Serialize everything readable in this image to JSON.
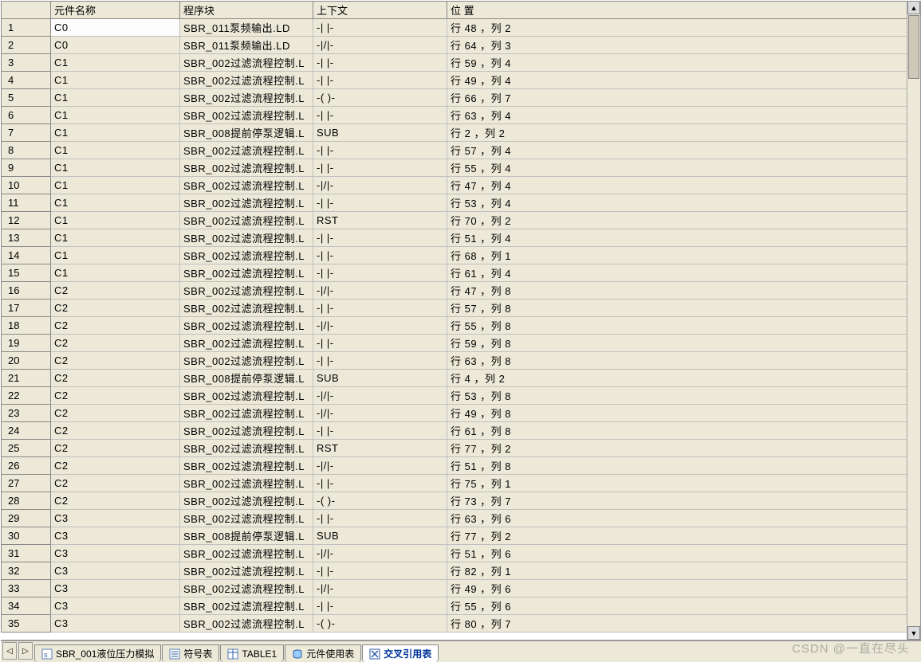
{
  "columns": {
    "name": "元件名称",
    "block": "程序块",
    "context": "上下文",
    "position": "位 置"
  },
  "rows": [
    {
      "n": "1",
      "name": "C0",
      "block": "SBR_011泵频输出.LD",
      "ctx": "-| |-",
      "pos": "行 48 ，列 2"
    },
    {
      "n": "2",
      "name": "C0",
      "block": "SBR_011泵频输出.LD",
      "ctx": "-|/|-",
      "pos": "行 64 ，列 3"
    },
    {
      "n": "3",
      "name": "C1",
      "block": "SBR_002过滤流程控制.L",
      "ctx": "-| |-",
      "pos": "行 59 ，列 4"
    },
    {
      "n": "4",
      "name": "C1",
      "block": "SBR_002过滤流程控制.L",
      "ctx": "-| |-",
      "pos": "行 49 ，列 4"
    },
    {
      "n": "5",
      "name": "C1",
      "block": "SBR_002过滤流程控制.L",
      "ctx": "-( )-",
      "pos": "行 66 ，列 7"
    },
    {
      "n": "6",
      "name": "C1",
      "block": "SBR_002过滤流程控制.L",
      "ctx": "-| |-",
      "pos": "行 63 ，列 4"
    },
    {
      "n": "7",
      "name": "C1",
      "block": "SBR_008提前停泵逻辑.L",
      "ctx": "SUB",
      "pos": "行 2 ，列 2"
    },
    {
      "n": "8",
      "name": "C1",
      "block": "SBR_002过滤流程控制.L",
      "ctx": "-| |-",
      "pos": "行 57 ，列 4"
    },
    {
      "n": "9",
      "name": "C1",
      "block": "SBR_002过滤流程控制.L",
      "ctx": "-| |-",
      "pos": "行 55 ，列 4"
    },
    {
      "n": "10",
      "name": "C1",
      "block": "SBR_002过滤流程控制.L",
      "ctx": "-|/|-",
      "pos": "行 47 ，列 4"
    },
    {
      "n": "11",
      "name": "C1",
      "block": "SBR_002过滤流程控制.L",
      "ctx": "-| |-",
      "pos": "行 53 ，列 4"
    },
    {
      "n": "12",
      "name": "C1",
      "block": "SBR_002过滤流程控制.L",
      "ctx": "RST",
      "pos": "行 70 ，列 2"
    },
    {
      "n": "13",
      "name": "C1",
      "block": "SBR_002过滤流程控制.L",
      "ctx": "-| |-",
      "pos": "行 51 ，列 4"
    },
    {
      "n": "14",
      "name": "C1",
      "block": "SBR_002过滤流程控制.L",
      "ctx": "-| |-",
      "pos": "行 68 ，列 1"
    },
    {
      "n": "15",
      "name": "C1",
      "block": "SBR_002过滤流程控制.L",
      "ctx": "-| |-",
      "pos": "行 61 ，列 4"
    },
    {
      "n": "16",
      "name": "C2",
      "block": "SBR_002过滤流程控制.L",
      "ctx": "-|/|-",
      "pos": "行 47 ，列 8"
    },
    {
      "n": "17",
      "name": "C2",
      "block": "SBR_002过滤流程控制.L",
      "ctx": "-| |-",
      "pos": "行 57 ，列 8"
    },
    {
      "n": "18",
      "name": "C2",
      "block": "SBR_002过滤流程控制.L",
      "ctx": "-|/|-",
      "pos": "行 55 ，列 8"
    },
    {
      "n": "19",
      "name": "C2",
      "block": "SBR_002过滤流程控制.L",
      "ctx": "-| |-",
      "pos": "行 59 ，列 8"
    },
    {
      "n": "20",
      "name": "C2",
      "block": "SBR_002过滤流程控制.L",
      "ctx": "-| |-",
      "pos": "行 63 ，列 8"
    },
    {
      "n": "21",
      "name": "C2",
      "block": "SBR_008提前停泵逻辑.L",
      "ctx": "SUB",
      "pos": "行 4 ，列 2"
    },
    {
      "n": "22",
      "name": "C2",
      "block": "SBR_002过滤流程控制.L",
      "ctx": "-|/|-",
      "pos": "行 53 ，列 8"
    },
    {
      "n": "23",
      "name": "C2",
      "block": "SBR_002过滤流程控制.L",
      "ctx": "-|/|-",
      "pos": "行 49 ，列 8"
    },
    {
      "n": "24",
      "name": "C2",
      "block": "SBR_002过滤流程控制.L",
      "ctx": "-| |-",
      "pos": "行 61 ，列 8"
    },
    {
      "n": "25",
      "name": "C2",
      "block": "SBR_002过滤流程控制.L",
      "ctx": "RST",
      "pos": "行 77 ，列 2"
    },
    {
      "n": "26",
      "name": "C2",
      "block": "SBR_002过滤流程控制.L",
      "ctx": "-|/|-",
      "pos": "行 51 ，列 8"
    },
    {
      "n": "27",
      "name": "C2",
      "block": "SBR_002过滤流程控制.L",
      "ctx": "-| |-",
      "pos": "行 75 ，列 1"
    },
    {
      "n": "28",
      "name": "C2",
      "block": "SBR_002过滤流程控制.L",
      "ctx": "-( )-",
      "pos": "行 73 ，列 7"
    },
    {
      "n": "29",
      "name": "C3",
      "block": "SBR_002过滤流程控制.L",
      "ctx": "-| |-",
      "pos": "行 63 ，列 6"
    },
    {
      "n": "30",
      "name": "C3",
      "block": "SBR_008提前停泵逻辑.L",
      "ctx": "SUB",
      "pos": "行 77 ，列 2"
    },
    {
      "n": "31",
      "name": "C3",
      "block": "SBR_002过滤流程控制.L",
      "ctx": "-|/|-",
      "pos": "行 51 ，列 6"
    },
    {
      "n": "32",
      "name": "C3",
      "block": "SBR_002过滤流程控制.L",
      "ctx": "-| |-",
      "pos": "行 82 ，列 1"
    },
    {
      "n": "33",
      "name": "C3",
      "block": "SBR_002过滤流程控制.L",
      "ctx": "-|/|-",
      "pos": "行 49 ，列 6"
    },
    {
      "n": "34",
      "name": "C3",
      "block": "SBR_002过滤流程控制.L",
      "ctx": "-| |-",
      "pos": "行 55 ，列 6"
    },
    {
      "n": "35",
      "name": "C3",
      "block": "SBR_002过滤流程控制.L",
      "ctx": "-( )-",
      "pos": "行 80 ，列 7"
    }
  ],
  "tabs": [
    {
      "label": "SBR_001液位压力模拟",
      "icon": "ladder"
    },
    {
      "label": "符号表",
      "icon": "symbol"
    },
    {
      "label": "TABLE1",
      "icon": "table"
    },
    {
      "label": "元件使用表",
      "icon": "db"
    },
    {
      "label": "交叉引用表",
      "icon": "xref",
      "active": true
    }
  ],
  "watermark": "CSDN @一直在尽头",
  "scroll": {
    "left": "◁",
    "right": "▷",
    "up": "▲",
    "down": "▼"
  }
}
